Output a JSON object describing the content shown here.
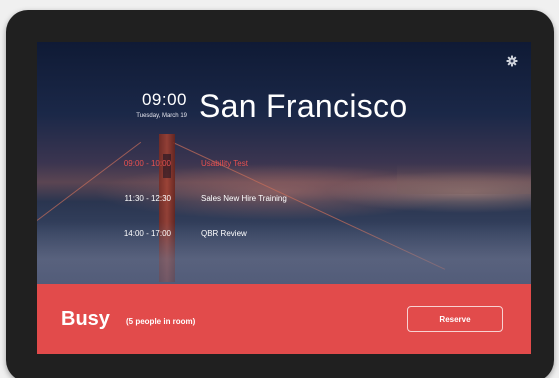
{
  "clock": {
    "time": "09:00",
    "date": "Tuesday, March 19"
  },
  "room": {
    "name": "San Francisco"
  },
  "schedule": [
    {
      "range": "09:00 - 10:00",
      "title": "Usability Test",
      "active": true
    },
    {
      "range": "11:30 - 12:30",
      "title": "Sales New Hire Training",
      "active": false
    },
    {
      "range": "14:00 - 17:00",
      "title": "QBR Review",
      "active": false
    }
  ],
  "status": {
    "state": "Busy",
    "occupancy": "(5 people in room)",
    "reserve_label": "Reserve"
  },
  "icons": {
    "settings": "gear-icon"
  },
  "colors": {
    "busy": "#e24b4b",
    "active_event": "#e8514f",
    "bezel": "#202020"
  }
}
